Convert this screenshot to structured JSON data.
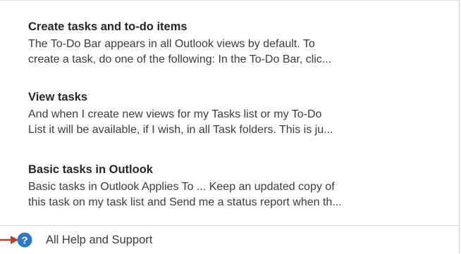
{
  "results": [
    {
      "title": "Create tasks and to-do items",
      "line1": "The To-Do Bar appears in all Outlook views by default. To",
      "line2": "create a task, do one of the following: In the To-Do Bar, clic..."
    },
    {
      "title": "View tasks",
      "line1": "And when I create new views for my Tasks list or my To-Do",
      "line2": "List it will be available, if I wish, in all Task folders. This is ju..."
    },
    {
      "title": "Basic tasks in Outlook",
      "line1": "Basic tasks in Outlook Applies To ... Keep an updated copy of",
      "line2": "this task on my task list and Send me a status report when th..."
    }
  ],
  "help": {
    "label": "All Help and Support",
    "icon": "question-circle-icon",
    "icon_color": "#2b79c9"
  },
  "annotation": {
    "arrow_color": "#c0392b"
  }
}
